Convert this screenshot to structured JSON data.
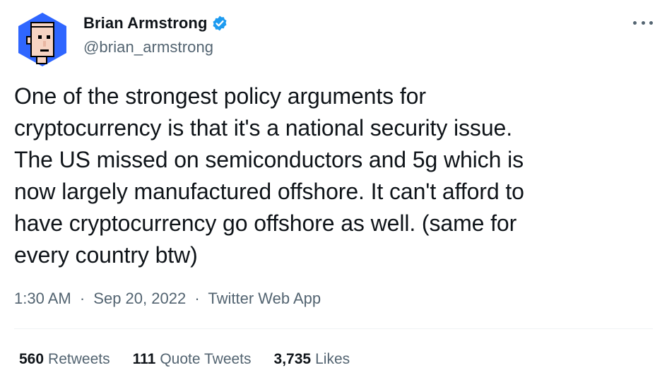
{
  "author": {
    "display_name": "Brian Armstrong",
    "handle": "@brian_armstrong",
    "verified": true,
    "avatar_icon": "pixel-face-avatar",
    "avatar_bg_color": "#2f66ff"
  },
  "more_icon": "more-horizontal-icon",
  "tweet": {
    "lines": [
      "One of the strongest policy arguments for",
      "cryptocurrency is that it's a national security issue.",
      "The US missed on semiconductors and 5g which is",
      "now largely manufactured offshore. It can't afford to",
      "have cryptocurrency go offshore as well. (same for",
      "every country btw)"
    ]
  },
  "meta": {
    "time": "1:30 AM",
    "separator": "·",
    "date": "Sep 20, 2022",
    "source": "Twitter Web App"
  },
  "stats": {
    "retweets_count": "560",
    "retweets_label": "Retweets",
    "quotes_count": "111",
    "quotes_label": "Quote Tweets",
    "likes_count": "3,735",
    "likes_label": "Likes"
  },
  "colors": {
    "text_primary": "#0f1419",
    "text_secondary": "#536471",
    "verified_blue": "#1d9bf0",
    "divider": "#eff3f4"
  }
}
